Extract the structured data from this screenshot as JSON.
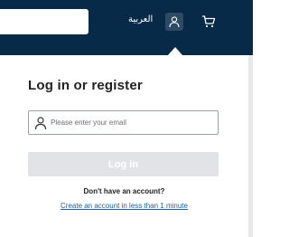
{
  "header": {
    "language_label": "العربية",
    "icons": {
      "account": "user-icon",
      "cart": "cart-icon"
    },
    "colors": {
      "background": "#072a49",
      "account_active_bg": "#2f4a64"
    }
  },
  "login": {
    "title": "Log in or register",
    "email_placeholder": "Please enter your email",
    "email_value": "",
    "submit_label": "Log in",
    "no_account_text": "Don't have an account?",
    "create_account_link": "Create an account in less than 1 minute"
  }
}
